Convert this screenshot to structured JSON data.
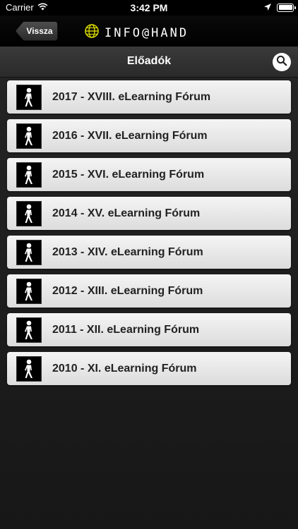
{
  "status_bar": {
    "carrier": "Carrier",
    "time": "3:42 PM"
  },
  "header": {
    "back_label": "Vissza",
    "logo_text": "INFO@HAND"
  },
  "title_bar": {
    "title": "Előadók",
    "search_icon": "search-icon"
  },
  "list": {
    "item_icon": "pedestrian-walk-icon",
    "items": [
      {
        "label": "2017 - XVIII. eLearning Fórum"
      },
      {
        "label": "2016 - XVII. eLearning Fórum"
      },
      {
        "label": "2015 - XVI. eLearning Fórum"
      },
      {
        "label": "2014 - XV. eLearning Fórum"
      },
      {
        "label": "2013 - XIV. eLearning Fórum"
      },
      {
        "label": "2012 - XIII. eLearning Fórum"
      },
      {
        "label": "2011 - XII. eLearning Fórum"
      },
      {
        "label": "2010 - XI. eLearning Fórum"
      }
    ]
  },
  "colors": {
    "background": "#1e1e1e",
    "list_item_bg": "#e8e8e8",
    "logo_accent": "#d4d400"
  }
}
